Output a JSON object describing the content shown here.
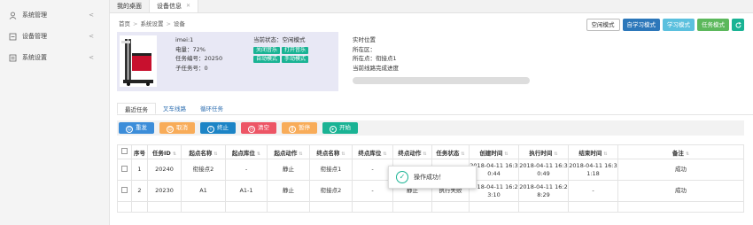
{
  "sidebar": {
    "items": [
      {
        "label": "系统管理",
        "icon": "user-icon"
      },
      {
        "label": "设备管理",
        "icon": "device-icon"
      },
      {
        "label": "系统设置",
        "icon": "settings-icon"
      }
    ]
  },
  "tabs": [
    {
      "label": "我的桌面"
    },
    {
      "label": "设备信息"
    }
  ],
  "breadcrumb": [
    "首页",
    "系统设置",
    "设备"
  ],
  "mode_buttons": {
    "idle": "空闲模式",
    "self_learn": "自学习模式",
    "learn": "学习模式",
    "task": "任务模式"
  },
  "device": {
    "imei": "imei:1",
    "battery": "电量：72%",
    "task_no": "任务编号：20250",
    "subtask_no": "子任务号：0",
    "status": "当前状态：空闲模式",
    "btn_close_music": "关闭音乐",
    "btn_open_music": "打开音乐",
    "btn_auto_mode": "自动模式",
    "btn_manual_mode": "手动模式",
    "realtime_pos": "实时位置",
    "at_zone": "所在区：",
    "at_point": "所在点：衔接点1",
    "route_progress": "当前线路完成进度",
    "route_progress_value": 0
  },
  "subtabs": [
    "最近任务",
    "叉车线路",
    "循环任务"
  ],
  "actions": {
    "resend": "重发",
    "cancel": "取消",
    "stop": "终止",
    "clear": "清空",
    "pause": "暂停",
    "start": "开始"
  },
  "table": {
    "headers": [
      "序号",
      "任务ID",
      "起点名称",
      "起点库位",
      "起点动作",
      "终点名称",
      "终点库位",
      "终点动作",
      "任务状态",
      "创建时间",
      "执行时间",
      "结束时间",
      "备注"
    ],
    "rows": [
      [
        "1",
        "20240",
        "衔接点2",
        "-",
        "静止",
        "衔接点1",
        "-",
        "",
        "",
        "2018-04-11 16:3 0:44",
        "2018-04-11 16:3 0:49",
        "2018-04-11 16:3 1:18",
        "成功"
      ],
      [
        "2",
        "20230",
        "A1",
        "A1-1",
        "静止",
        "衔接点2",
        "-",
        "静止",
        "执行失败",
        "2018-04-11 16:2 3:10",
        "2018-04-11 16:2 8:29",
        "-",
        "成功"
      ]
    ]
  },
  "toast": {
    "message": "操作成功！"
  }
}
